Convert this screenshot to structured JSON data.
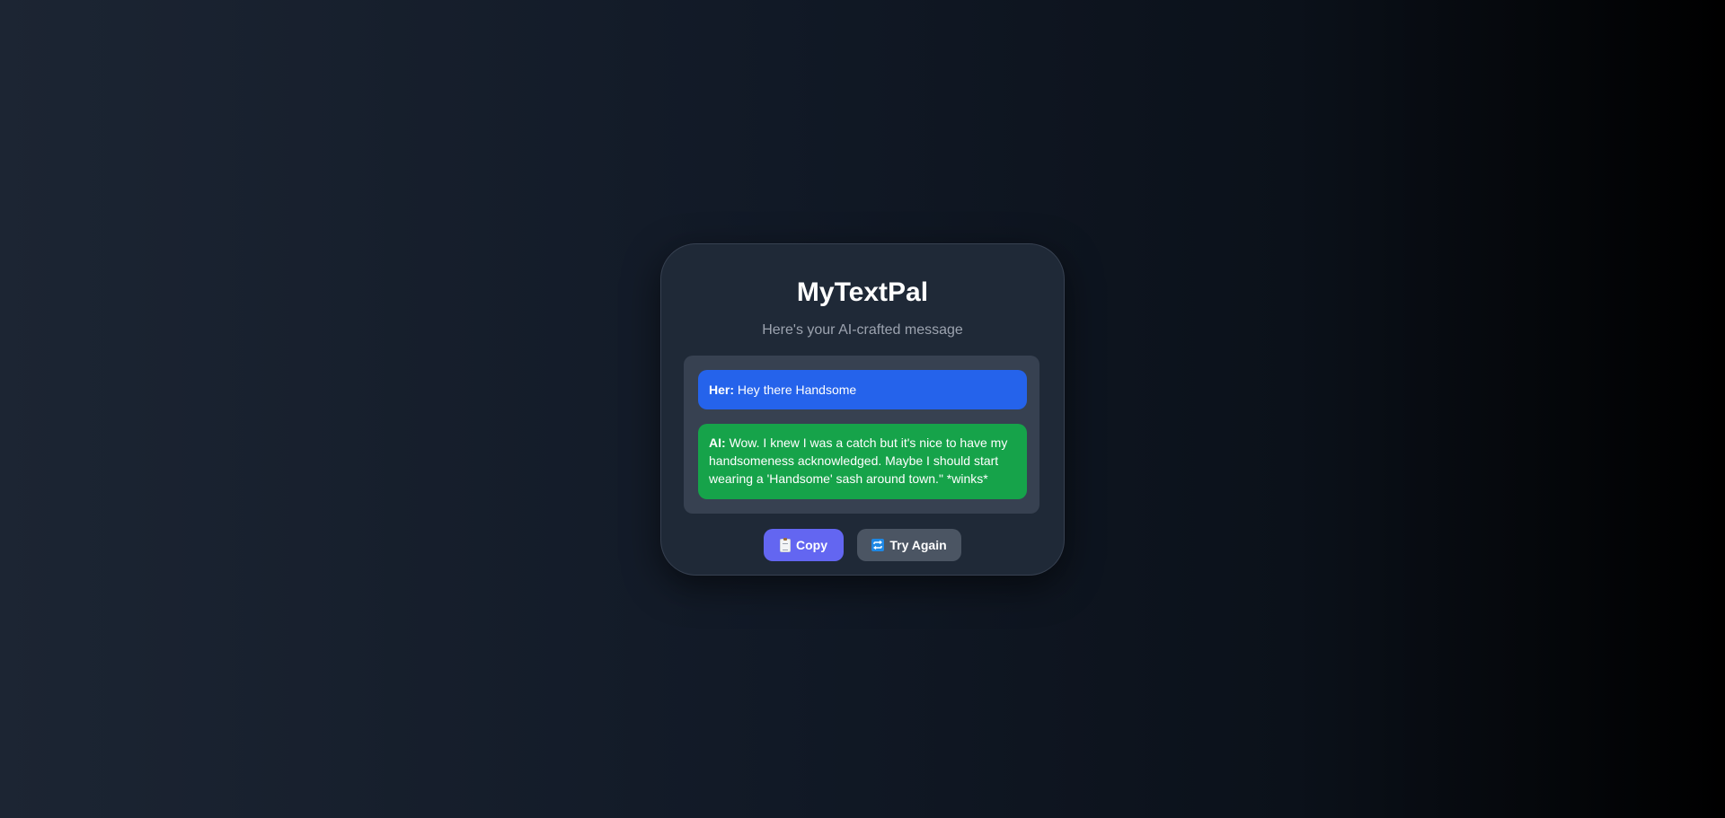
{
  "app": {
    "title": "MyTextPal",
    "subtitle": "Here's your AI-crafted message"
  },
  "conversation": [
    {
      "speaker": "Her:",
      "text": "Hey there Handsome",
      "color": "#2563eb"
    },
    {
      "speaker": "AI:",
      "text": "Wow. I knew I was a catch but it's nice to have my handsomeness acknowledged. Maybe I should start wearing a 'Handsome' sash around town.\" *winks*",
      "color": "#16a34a"
    }
  ],
  "actions": {
    "copy": {
      "label": "Copy",
      "icon": "clipboard-icon",
      "color": "#6366f1"
    },
    "retry": {
      "label": "Try Again",
      "icon": "repeat-icon",
      "color": "#4b5563"
    }
  }
}
